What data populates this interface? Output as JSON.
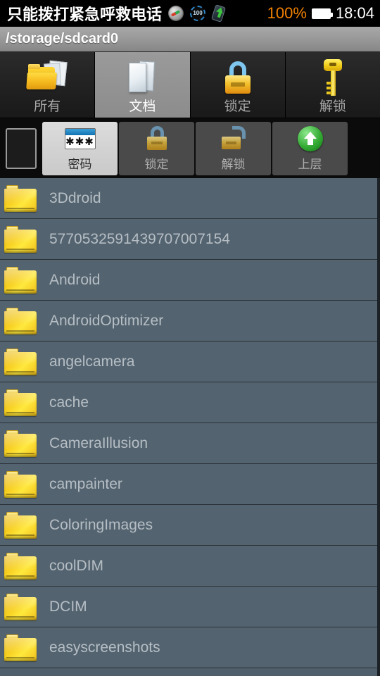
{
  "statusbar": {
    "carrier_text": "只能拨打紧急呼救电话",
    "icons": [
      "compass-icon",
      "badge-100-icon",
      "phone-upload-icon"
    ],
    "badge_value": "100",
    "battery_percent": "100%",
    "battery_color": "#f08000",
    "time": "18:04"
  },
  "titlebar": {
    "path": "/storage/sdcard0"
  },
  "tabs": [
    {
      "label": "所有",
      "icon": "folder-documents-icon",
      "active": false
    },
    {
      "label": "文档",
      "icon": "documents-icon",
      "active": true
    },
    {
      "label": "锁定",
      "icon": "padlock-closed-icon",
      "active": false
    },
    {
      "label": "解锁",
      "icon": "key-icon",
      "active": false
    }
  ],
  "actionbar": {
    "checkbox": {
      "name": "select-all-checkbox",
      "checked": false
    },
    "buttons": [
      {
        "label": "密码",
        "icon": "password-dialog-icon",
        "style": "light",
        "stars": "✱✱✱"
      },
      {
        "label": "锁定",
        "icon": "padlock-closed-small-icon",
        "style": "dark"
      },
      {
        "label": "解锁",
        "icon": "padlock-open-small-icon",
        "style": "dark"
      },
      {
        "label": "上层",
        "icon": "up-arrow-green-icon",
        "style": "dark"
      }
    ]
  },
  "filelist": {
    "row_bg": "#53636f",
    "text_color": "#b6bec5",
    "items": [
      {
        "name": "3Ddroid",
        "icon": "folder-icon"
      },
      {
        "name": "5770532591439707007154",
        "icon": "folder-icon"
      },
      {
        "name": "Android",
        "icon": "folder-icon"
      },
      {
        "name": "AndroidOptimizer",
        "icon": "folder-icon"
      },
      {
        "name": "angelcamera",
        "icon": "folder-icon"
      },
      {
        "name": "cache",
        "icon": "folder-icon"
      },
      {
        "name": "CameraIllusion",
        "icon": "folder-icon"
      },
      {
        "name": "campainter",
        "icon": "folder-icon"
      },
      {
        "name": "ColoringImages",
        "icon": "folder-icon"
      },
      {
        "name": "coolDIM",
        "icon": "folder-icon"
      },
      {
        "name": "DCIM",
        "icon": "folder-icon"
      },
      {
        "name": "easyscreenshots",
        "icon": "folder-icon"
      }
    ]
  }
}
